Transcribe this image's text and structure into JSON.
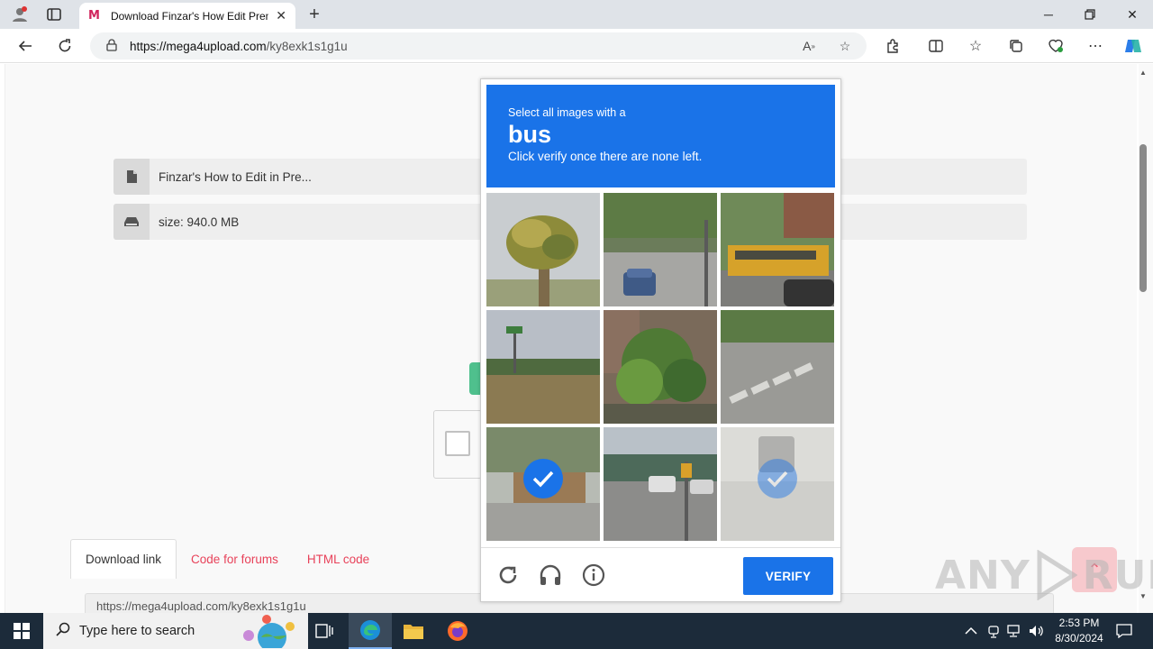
{
  "browser": {
    "tab_title": "Download Finzar's How Edit Prem",
    "tab_favicon": "M",
    "url_host": "https://mega4upload.com",
    "url_path": "/ky8exk1s1g1u"
  },
  "page": {
    "file_name": "Finzar's How to Edit in Pre...",
    "file_size": "size: 940.0 MB",
    "tabs": [
      {
        "label": "Download link"
      },
      {
        "label": "Code for forums"
      },
      {
        "label": "HTML code"
      }
    ],
    "link_value": "https://mega4upload.com/ky8exk1s1g1u"
  },
  "captcha": {
    "instruction_prefix": "Select all images with a",
    "target_object": "bus",
    "instruction_hint": "Click verify once there are none left.",
    "verify_label": "VERIFY",
    "tiles": [
      {
        "subject": "palm-tree",
        "selected": false
      },
      {
        "subject": "road-with-car",
        "selected": false
      },
      {
        "subject": "school-bus",
        "selected": false
      },
      {
        "subject": "roadside-field",
        "selected": false
      },
      {
        "subject": "garden-plants",
        "selected": false
      },
      {
        "subject": "crosswalk",
        "selected": false
      },
      {
        "subject": "bus-on-road",
        "selected": true
      },
      {
        "subject": "parking-lot",
        "selected": false
      },
      {
        "subject": "faded-vehicle",
        "selected": true
      }
    ]
  },
  "taskbar": {
    "search_placeholder": "Type here to search",
    "time": "2:53 PM",
    "date": "8/30/2024"
  },
  "watermark": {
    "text_left": "ANY",
    "text_right": "RUN"
  },
  "colors": {
    "captcha_blue": "#1a73e8",
    "link_red": "#e8425a",
    "taskbar_bg": "#1c2b3a"
  }
}
